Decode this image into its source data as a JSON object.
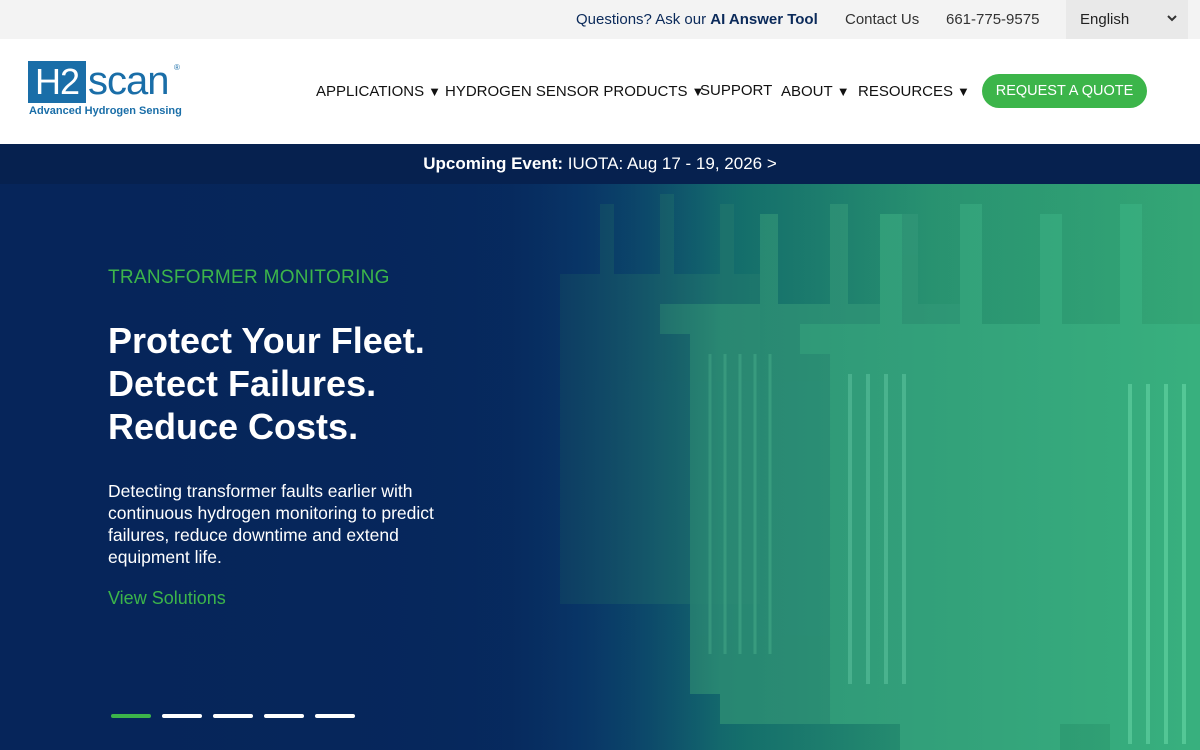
{
  "topbar": {
    "ask_prefix": "Questions? Ask our ",
    "ask_link": "AI Answer Tool",
    "contact": "Contact Us",
    "phone": "661-775-9575",
    "language": "English",
    "language_icon": "chevron-down-icon"
  },
  "logo": {
    "box_text": "H2",
    "scan_text": "scan",
    "registered": "®",
    "tagline": "Advanced Hydrogen Sensing"
  },
  "nav": {
    "items": [
      {
        "label": "APPLICATIONS",
        "arrow": "▼"
      },
      {
        "label": "HYDROGEN SENSOR PRODUCTS",
        "arrow": "▼"
      },
      {
        "label": "SUPPORT",
        "arrow": ""
      },
      {
        "label": "ABOUT",
        "arrow": "▼"
      },
      {
        "label": "RESOURCES",
        "arrow": "▼"
      }
    ],
    "quote": "REQUEST A QUOTE"
  },
  "event": {
    "label": "Upcoming Event:",
    "text": " IUOTA: Aug 17 - 19, 2026 >"
  },
  "hero": {
    "eyebrow": "TRANSFORMER MONITORING",
    "headline": [
      "Protect Your Fleet.",
      "Detect Failures.",
      "Reduce Costs."
    ],
    "description": "Detecting transformer faults earlier with continuous hydrogen monitoring to predict failures, reduce downtime and extend equipment life.",
    "cta": "View Solutions",
    "slides_total": 5,
    "active_slide": 1
  },
  "colors": {
    "brand_blue": "#1a6ea8",
    "accent_green": "#3cb54a",
    "navy": "#06214f"
  }
}
